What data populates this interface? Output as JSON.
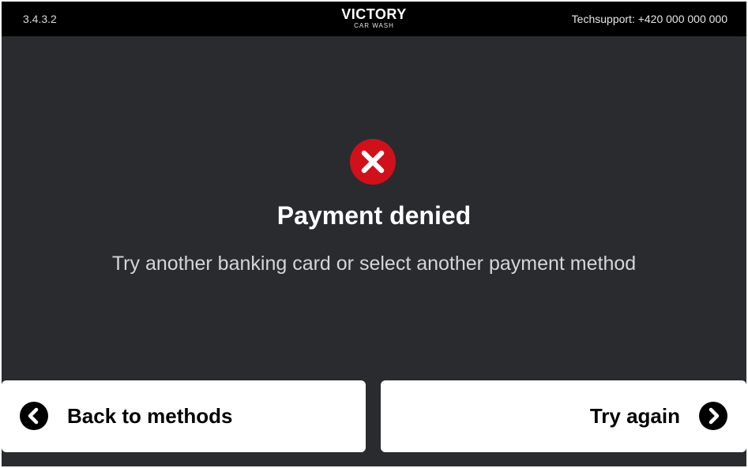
{
  "header": {
    "version": "3.4.3.2",
    "brand_name": "VICTORY",
    "brand_subtitle": "CAR WASH",
    "techsupport": "Techsupport: +420 000 000 000"
  },
  "status": {
    "icon": "error-x-icon",
    "icon_color": "#d0101b",
    "title": "Payment denied",
    "message": "Try another banking card or select another payment method"
  },
  "actions": {
    "back_label": "Back to methods",
    "back_icon": "chevron-left-circle-icon",
    "retry_label": "Try again",
    "retry_icon": "chevron-right-circle-icon"
  },
  "colors": {
    "background": "#2a2b2f",
    "topbar": "#000000",
    "button": "#ffffff",
    "accent_error": "#d0101b"
  }
}
